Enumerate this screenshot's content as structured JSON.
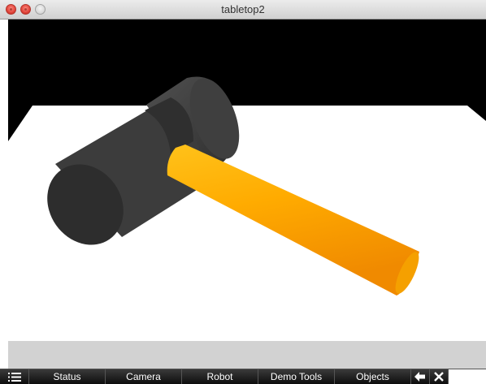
{
  "window": {
    "title": "tabletop2"
  },
  "scene": {
    "background_color": "#000000",
    "table_color": "#ffffff",
    "hammer_head_color": "#3c3c3c",
    "hammer_handle_color": "#ffa500"
  },
  "toolbar": {
    "menu_icon": "list-icon",
    "buttons": [
      {
        "label": "Status"
      },
      {
        "label": "Camera"
      },
      {
        "label": "Robot"
      },
      {
        "label": "Demo Tools"
      },
      {
        "label": "Objects"
      }
    ],
    "back_icon": "arrow-left-icon",
    "close_icon": "close-icon"
  }
}
